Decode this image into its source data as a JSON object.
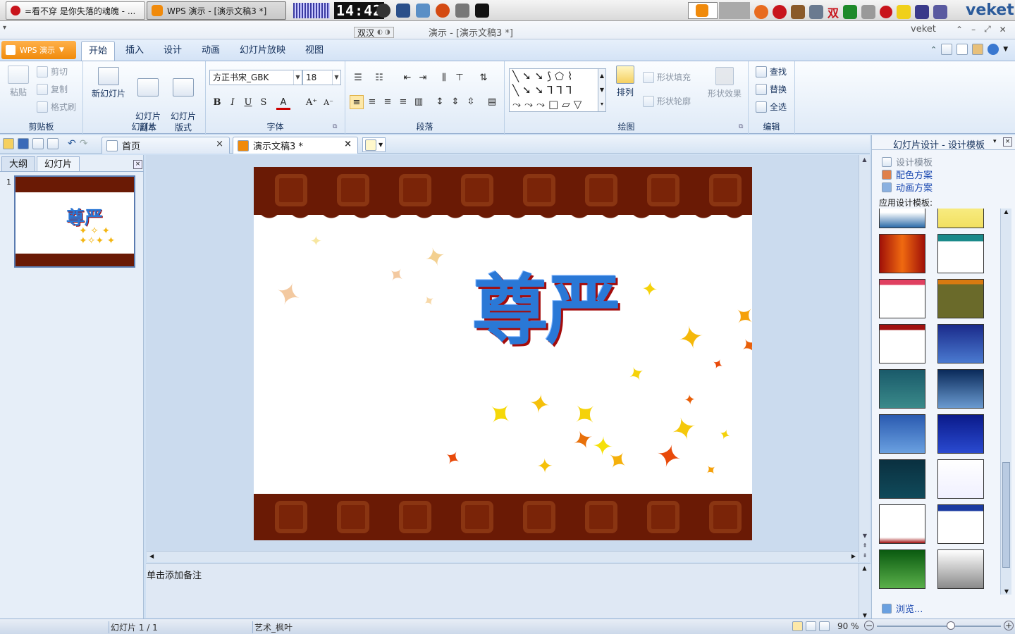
{
  "taskbar": {
    "tasks": [
      {
        "label": "=看不穿 是你失落的魂魄 - ..."
      },
      {
        "label": "WPS 演示 - [演示文稿3 *]"
      }
    ],
    "clock": "14:42",
    "brand": "veket",
    "tray_input": "双"
  },
  "titlebar": {
    "ime": "双汉",
    "title": "演示 - [演示文稿3 *]",
    "user": "veket"
  },
  "ribbon": {
    "app_menu": "WPS 演示",
    "tabs": [
      "开始",
      "插入",
      "设计",
      "动画",
      "幻灯片放映",
      "视图"
    ],
    "clipboard": {
      "paste": "粘贴",
      "cut": "剪切",
      "copy": "复制",
      "format_painter": "格式刷",
      "label": "剪贴板"
    },
    "slides": {
      "new_slide": "新幻灯片",
      "duplicate": "幻灯片\n副本",
      "layout": "幻灯片\n版式",
      "label": "幻灯片"
    },
    "font": {
      "name": "方正书宋_GBK",
      "size": "18",
      "label": "字体"
    },
    "paragraph": {
      "label": "段落"
    },
    "drawing": {
      "arrange": "排列",
      "fill": "形状填充",
      "outline": "形状轮廓",
      "effect": "形状效果",
      "label": "绘图"
    },
    "editing": {
      "find": "查找",
      "replace": "替换",
      "select_all": "全选",
      "label": "编辑"
    }
  },
  "doc_tabs": [
    {
      "label": "首页"
    },
    {
      "label": "演示文稿3 *"
    }
  ],
  "left_pane": {
    "tabs": [
      "大纲",
      "幻灯片"
    ],
    "slide_number": "1",
    "thumb_title": "尊严"
  },
  "slide": {
    "title": "尊严"
  },
  "notes": {
    "placeholder": "单击添加备注"
  },
  "right_pane": {
    "title": "幻灯片设计 - 设计模板",
    "links": [
      "设计模板",
      "配色方案",
      "动画方案"
    ],
    "section": "应用设计模板:",
    "browse": "浏览..."
  },
  "status": {
    "slide_info": "幻灯片 1 / 1",
    "template": "艺术_枫叶",
    "zoom": "90 %"
  },
  "colors": {
    "accent": "#2a78d6",
    "band": "#6a1a05",
    "wps_orange": "#f08a0b"
  }
}
